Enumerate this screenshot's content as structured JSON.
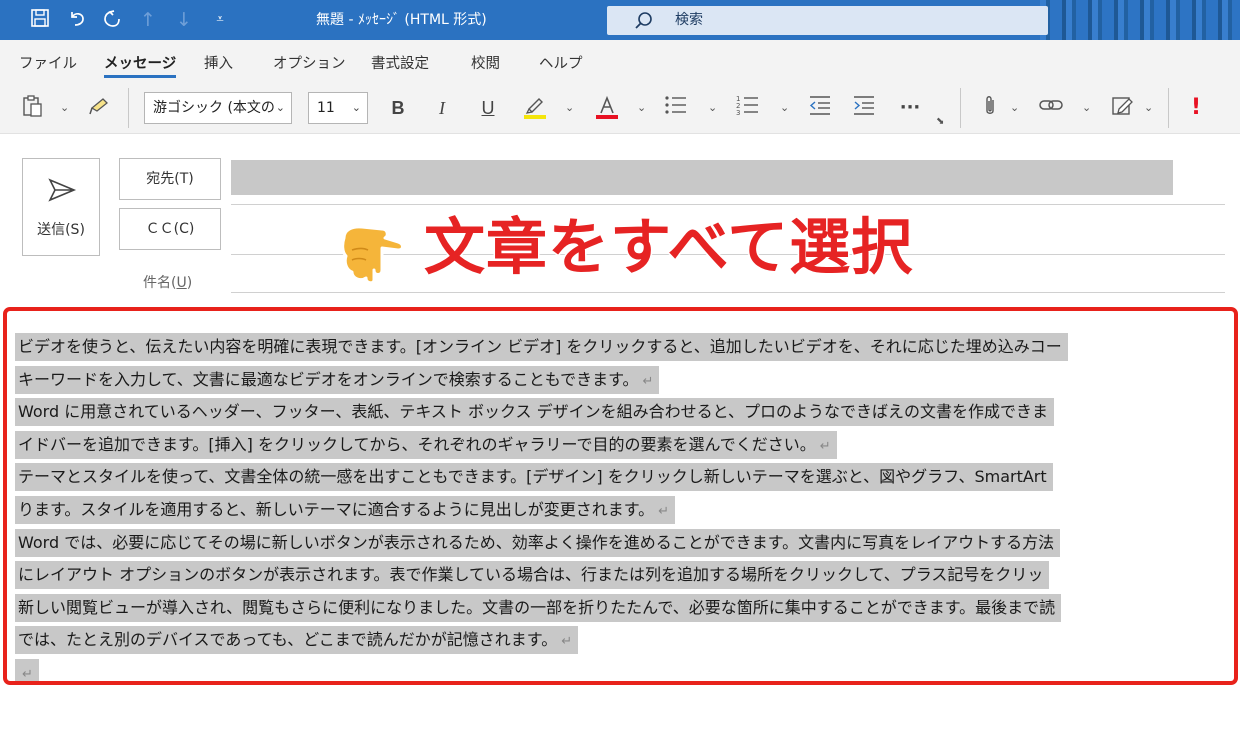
{
  "titlebar": {
    "title": "無題  -  ﾒｯｾｰｼﾞ (HTML 形式)",
    "search_label": "検索"
  },
  "menu": {
    "tabs": [
      "ファイル",
      "メッセージ",
      "挿入",
      "オプション",
      "書式設定",
      "校閲",
      "ヘルプ"
    ],
    "active": "メッセージ"
  },
  "ribbon": {
    "font_name": "游ゴシック (本文の",
    "font_size": "11",
    "bold": "B",
    "italic": "I",
    "underline": "U",
    "more": "···",
    "importance": "!"
  },
  "header": {
    "send_label": "送信(S)",
    "to_label": "宛先(T)",
    "cc_label": "ＣＣ(C)",
    "subject_label_prefix": "件名(",
    "subject_label_key": "U",
    "subject_label_suffix": ")"
  },
  "annotation": {
    "text": "文章をすべて選択"
  },
  "colors": {
    "titlebar": "#2b72c1",
    "annotation_red": "#e62323",
    "frame_red": "#e8221b",
    "selection_gray": "#c8c8c8",
    "highlight_yellow": "#f4e50c",
    "font_red": "#e81123"
  },
  "body": {
    "lines": [
      "ビデオを使うと、伝えたい内容を明確に表現できます。[オンライン ビデオ] をクリックすると、追加したいビデオを、それに応じた埋め込みコー",
      "キーワードを入力して、文書に最適なビデオをオンラインで検索することもできます。",
      "Word に用意されているヘッダー、フッター、表紙、テキスト ボックス デザインを組み合わせると、プロのようなできばえの文書を作成できま",
      "イドバーを追加できます。[挿入] をクリックしてから、それぞれのギャラリーで目的の要素を選んでください。",
      "テーマとスタイルを使って、文書全体の統一感を出すこともできます。[デザイン] をクリックし新しいテーマを選ぶと、図やグラフ、SmartArt",
      "ります。スタイルを適用すると、新しいテーマに適合するように見出しが変更されます。",
      "Word では、必要に応じてその場に新しいボタンが表示されるため、効率よく操作を進めることができます。文書内に写真をレイアウトする方法",
      "にレイアウト オプションのボタンが表示されます。表で作業している場合は、行または列を追加する場所をクリックして、プラス記号をクリッ",
      "新しい閲覧ビューが導入され、閲覧もさらに便利になりました。文書の一部を折りたたんで、必要な箇所に集中することができます。最後まで読",
      "では、たとえ別のデバイスであっても、どこまで読んだかが記憶されます。",
      ""
    ],
    "paragraph_mark": "↵"
  }
}
